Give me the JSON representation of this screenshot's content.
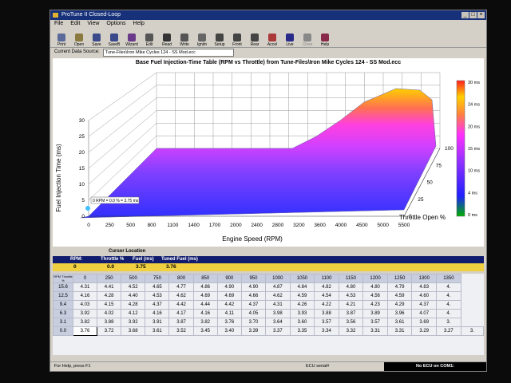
{
  "window": {
    "title": "ProTune II Closed-Loop"
  },
  "menu": [
    "File",
    "Edit",
    "View",
    "Options",
    "Help"
  ],
  "toolbar": [
    {
      "label": "Print",
      "icon": "print-icon",
      "color": "#5a6a9a"
    },
    {
      "label": "Open",
      "icon": "open-icon",
      "color": "#8a7a40"
    },
    {
      "label": "Save",
      "icon": "save-icon",
      "color": "#3a4a8a"
    },
    {
      "label": "SaveB",
      "icon": "save-b-icon",
      "color": "#3a4a8a"
    },
    {
      "label": "Wizard",
      "icon": "wizard-icon",
      "color": "#6a3a8a"
    },
    {
      "label": "Edit",
      "icon": "edit-icon",
      "color": "#555555"
    },
    {
      "label": "Read",
      "icon": "read-icon",
      "color": "#333333"
    },
    {
      "label": "Write",
      "icon": "write-icon",
      "color": "#555555"
    },
    {
      "label": "Ignitn",
      "icon": "ignition-icon",
      "color": "#666666"
    },
    {
      "label": "Setup",
      "icon": "setup-icon",
      "color": "#444444"
    },
    {
      "label": "Front",
      "icon": "front-icon",
      "color": "#444444"
    },
    {
      "label": "Rear",
      "icon": "rear-icon",
      "color": "#444444"
    },
    {
      "label": "Accel",
      "icon": "accel-icon",
      "color": "#aa3a3a"
    },
    {
      "label": "Live",
      "icon": "live-icon",
      "color": "#2a2a8a"
    },
    {
      "label": "Close",
      "icon": "close-icon",
      "color": "#888888",
      "dim": true
    },
    {
      "label": "Help",
      "icon": "help-book-icon",
      "color": "#8a2a4a"
    }
  ],
  "source": {
    "label": "Current Data Source:",
    "value": "Tune-Files\\Iron Mike Cycles 124 - SS Mod.ecc"
  },
  "chart_data": {
    "type": "surface3d",
    "title": "Base Fuel Injection-Time Table (RPM vs Throttle) from Tune-Files\\Iron Mike Cycles 124 - SS Mod.ecc",
    "xlabel": "Engine Speed (RPM)",
    "ylabel": "Throttle Open %",
    "zlabel": "Fuel Injection Time (ms)",
    "x_ticks": [
      "0",
      "250",
      "500",
      "800",
      "1100",
      "1400",
      "1700",
      "2000",
      "2400",
      "2800",
      "3200",
      "3600",
      "4000",
      "4500",
      "5000",
      "5500"
    ],
    "y_ticks": [
      "0",
      "25",
      "50",
      "75",
      "100"
    ],
    "z_ticks": [
      "0",
      "5",
      "10",
      "15",
      "20",
      "25",
      "30"
    ],
    "zlim": [
      0,
      30
    ],
    "colorbar": {
      "ticks": [
        "30 ms",
        "24 ms",
        "20 ms",
        "15 ms",
        "10 ms",
        "4 ms",
        "0 ms"
      ]
    },
    "cursor_label": "0 RPM = 0.0 % = 3.75 ms",
    "palette": [
      "#00a000",
      "#3030ff",
      "#8040ff",
      "#c040ff",
      "#ff40ff",
      "#ff60a0",
      "#ffa040",
      "#ffd000",
      "#ff3030"
    ]
  },
  "cursor": {
    "title": "Cursor Location",
    "headers": {
      "rpm": "RPM:",
      "throttle": "Throttle %",
      "fuel": "Fuel (ms)",
      "tuned": "Tuned Fuel (ms)"
    },
    "values": {
      "rpm": "0",
      "throttle": "0.0",
      "fuel": "3.75",
      "tuned": "3.76"
    }
  },
  "table": {
    "corner": "RPM\nThrottle %",
    "columns": [
      "0",
      "250",
      "500",
      "750",
      "800",
      "850",
      "900",
      "950",
      "1000",
      "1050",
      "1100",
      "1150",
      "1200",
      "1250",
      "1300",
      "1350"
    ],
    "rows": [
      {
        "label": "15.6",
        "cells": [
          "4.31",
          "4.41",
          "4.52",
          "4.65",
          "4.77",
          "4.86",
          "4.90",
          "4.90",
          "4.87",
          "4.84",
          "4.82",
          "4.80",
          "4.80",
          "4.79",
          "4.83",
          "4."
        ]
      },
      {
        "label": "12.5",
        "cells": [
          "4.16",
          "4.28",
          "4.40",
          "4.53",
          "4.62",
          "4.69",
          "4.69",
          "4.66",
          "4.62",
          "4.59",
          "4.54",
          "4.53",
          "4.56",
          "4.59",
          "4.60",
          "4."
        ]
      },
      {
        "label": "9.4",
        "cells": [
          "4.03",
          "4.15",
          "4.28",
          "4.37",
          "4.42",
          "4.44",
          "4.42",
          "4.37",
          "4.31",
          "4.26",
          "4.22",
          "4.21",
          "4.23",
          "4.29",
          "4.37",
          "4."
        ]
      },
      {
        "label": "6.3",
        "cells": [
          "3.92",
          "4.02",
          "4.12",
          "4.16",
          "4.17",
          "4.16",
          "4.11",
          "4.05",
          "3.98",
          "3.93",
          "3.88",
          "3.87",
          "3.89",
          "3.96",
          "4.07",
          "4."
        ]
      },
      {
        "label": "3.1",
        "cells": [
          "3.82",
          "3.88",
          "3.92",
          "3.91",
          "3.87",
          "3.82",
          "3.76",
          "3.70",
          "3.64",
          "3.60",
          "3.57",
          "3.56",
          "3.57",
          "3.61",
          "3.69",
          "3."
        ]
      },
      {
        "label": "0.0",
        "cells": [
          "3.76",
          "3.72",
          "3.68",
          "3.61",
          "3.52",
          "3.45",
          "3.40",
          "3.39",
          "3.37",
          "3.35",
          "3.34",
          "3.32",
          "3.31",
          "3.31",
          "3.29",
          "3.27",
          "3."
        ]
      }
    ]
  },
  "status": {
    "help": "For Help, press F1",
    "ecu": "ECU serial#",
    "connection": "No ECU on COM1:"
  }
}
